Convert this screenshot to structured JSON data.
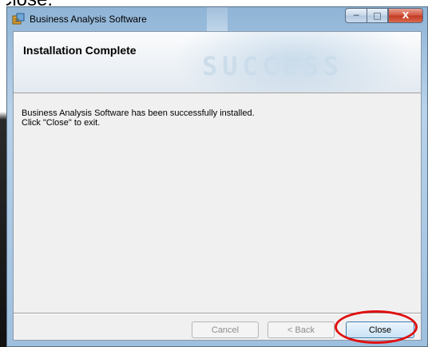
{
  "caption": "Close.",
  "window": {
    "title": "Business Analysis Software",
    "controls": {
      "minimize": "─",
      "maximize": "□",
      "close": "X"
    }
  },
  "banner": {
    "title": "Installation Complete",
    "background_word": "SUCCESS"
  },
  "body": {
    "line1": "Business Analysis Software has been successfully installed.",
    "line2": "Click \"Close\" to exit."
  },
  "buttons": {
    "cancel": "Cancel",
    "back": "< Back",
    "close": "Close"
  },
  "colors": {
    "highlight": "#e01010",
    "close_button_border": "#3c7fb1"
  }
}
